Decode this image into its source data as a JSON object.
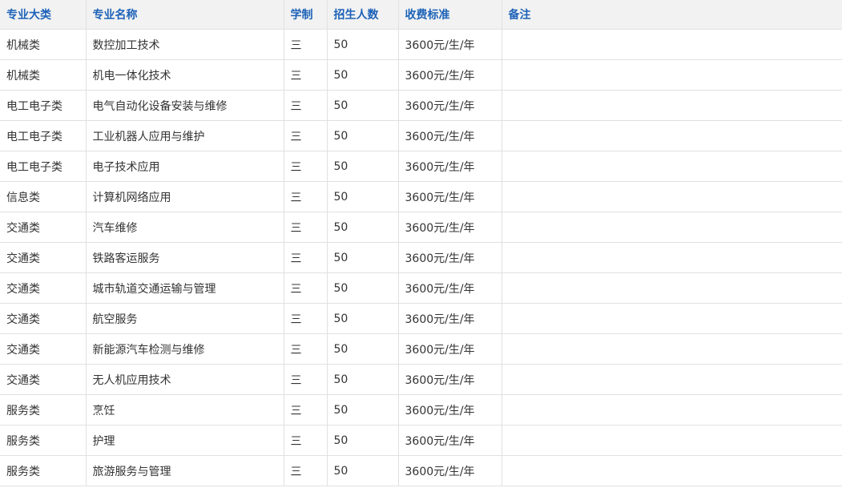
{
  "table": {
    "headers": [
      "专业大类",
      "专业名称",
      "学制",
      "招生人数",
      "收费标准",
      "备注"
    ],
    "rows": [
      [
        "机械类",
        "数控加工技术",
        "三",
        "50",
        "3600元/生/年",
        ""
      ],
      [
        "机械类",
        "机电一体化技术",
        "三",
        "50",
        "3600元/生/年",
        ""
      ],
      [
        "电工电子类",
        "电气自动化设备安装与维修",
        "三",
        "50",
        "3600元/生/年",
        ""
      ],
      [
        "电工电子类",
        "工业机器人应用与维护",
        "三",
        "50",
        "3600元/生/年",
        ""
      ],
      [
        "电工电子类",
        "电子技术应用",
        "三",
        "50",
        "3600元/生/年",
        ""
      ],
      [
        "信息类",
        "计算机网络应用",
        "三",
        "50",
        "3600元/生/年",
        ""
      ],
      [
        "交通类",
        "汽车维修",
        "三",
        "50",
        "3600元/生/年",
        ""
      ],
      [
        "交通类",
        "铁路客运服务",
        "三",
        "50",
        "3600元/生/年",
        ""
      ],
      [
        "交通类",
        "城市轨道交通运输与管理",
        "三",
        "50",
        "3600元/生/年",
        ""
      ],
      [
        "交通类",
        "航空服务",
        "三",
        "50",
        "3600元/生/年",
        ""
      ],
      [
        "交通类",
        "新能源汽车检测与维修",
        "三",
        "50",
        "3600元/生/年",
        ""
      ],
      [
        "交通类",
        "无人机应用技术",
        "三",
        "50",
        "3600元/生/年",
        ""
      ],
      [
        "服务类",
        "烹饪",
        "三",
        "50",
        "3600元/生/年",
        ""
      ],
      [
        "服务类",
        "护理",
        "三",
        "50",
        "3600元/生/年",
        ""
      ],
      [
        "服务类",
        "旅游服务与管理",
        "三",
        "50",
        "3600元/生/年",
        ""
      ]
    ]
  },
  "colors": {
    "header_text": "#1d62b8",
    "header_bg": "#f2f2f2",
    "border": "#e1e1e1",
    "body_text": "#333333"
  }
}
